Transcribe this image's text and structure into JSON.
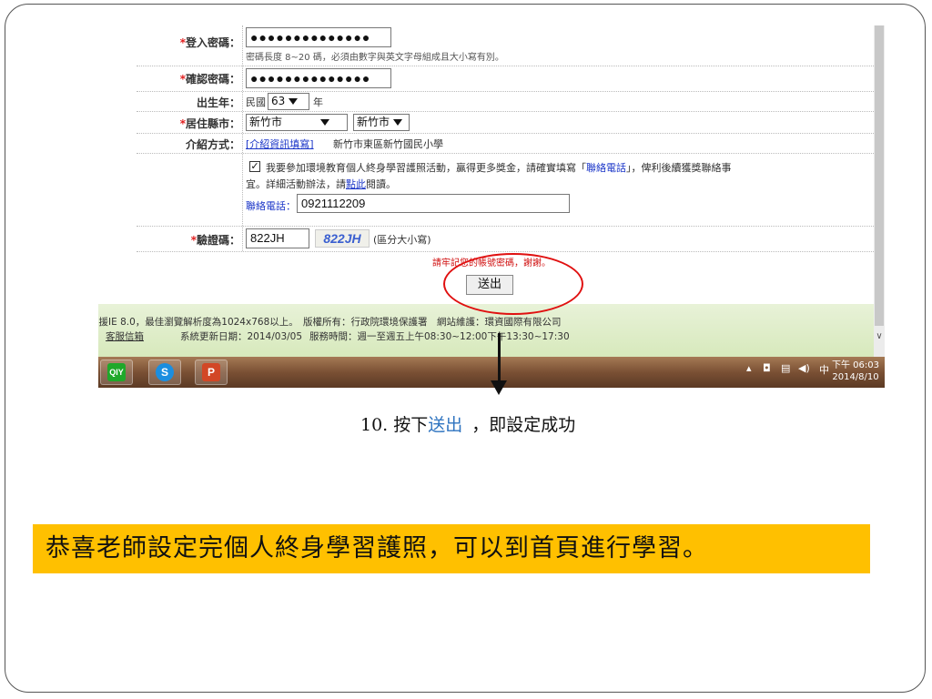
{
  "form": {
    "password_label": "登入密碼：",
    "password_value": "●●●●●●●●●●●●●●",
    "password_hint": "密碼長度 8~20 碼，必須由數字與英文字母組成且大小寫有別。",
    "confirm_label": "確認密碼：",
    "confirm_value": "●●●●●●●●●●●●●●",
    "birth_label": "出生年：",
    "birth_prefix": "民國",
    "birth_year": "63",
    "birth_suffix": "年",
    "city_label": "居住縣市：",
    "city_select_1": "新竹市",
    "city_select_2": "新竹市",
    "referral_label": "介紹方式：",
    "referral_link": "[介紹資訊填寫]",
    "referral_value": "新竹市東區新竹國民小學",
    "activity_text_1": "我要參加環境教育個人終身學習護照活動，贏得更多獎金，請確實填寫「",
    "activity_highlight": "聯絡電話",
    "activity_text_2": "」，俾利後續獲獎聯絡事",
    "activity_text_3": "宜。詳細活動辦法，請",
    "activity_link": "點此",
    "activity_text_4": "閱讀。",
    "phone_label": "聯絡電話：",
    "phone_value": "0921112209",
    "captcha_label": "驗證碼：",
    "captcha_value": "822JH",
    "captcha_image_text": "822JH",
    "captcha_note": "(區分大小寫)",
    "remember_note": "請牢記您的帳號密碼，謝謝。",
    "submit_label": "送出"
  },
  "footer": {
    "line1": "支援IE 8.0，最佳瀏覽解析度為1024x768以上。　版權所有：行政院環境保護署　網站維護：環資國際有限公司",
    "service_link": "客服信箱",
    "update": "系統更新日期：2014/03/05",
    "hours": "服務時間：週一至週五上午08:30~12:00下午13:30~17:30"
  },
  "taskbar": {
    "tray_ime": "中",
    "time": "下午 06:03",
    "date": "2014/8/10"
  },
  "slide": {
    "step_prefix": "10. 按下",
    "step_keyword": "送出",
    "step_suffix": "，即設定成功",
    "banner": "恭喜老師設定完個人終身學習護照，可以到首頁進行學習。"
  },
  "colors": {
    "banner_bg": "#ffc000",
    "highlight_ellipse": "#e01010",
    "keyword_blue": "#2f74c0",
    "required_mark": "#dd0000"
  },
  "icons": [
    "iqiyi-icon",
    "skype-icon",
    "powerpoint-icon",
    "shield-icon",
    "network-icon",
    "volume-icon"
  ]
}
